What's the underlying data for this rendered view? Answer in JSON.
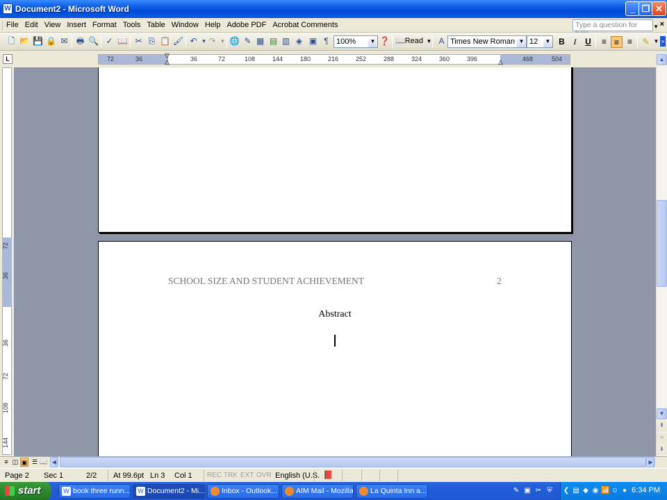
{
  "window": {
    "title": "Document2 - Microsoft Word",
    "app_icon": "W"
  },
  "menu": {
    "items": [
      "File",
      "Edit",
      "View",
      "Insert",
      "Format",
      "Tools",
      "Table",
      "Window",
      "Help",
      "Adobe PDF",
      "Acrobat Comments"
    ],
    "help_placeholder": "Type a question for help",
    "close_glyph": "×"
  },
  "toolbar": {
    "zoom": "100%",
    "read_label": "Read",
    "font_name": "Times New Roman",
    "font_size": "12",
    "bold": "B",
    "italic": "I",
    "underline": "U",
    "para_mark": "¶"
  },
  "ruler": {
    "h_ticks": [
      "72",
      "36",
      "36",
      "72",
      "108",
      "144",
      "180",
      "216",
      "252",
      "288",
      "324",
      "360",
      "396",
      "468",
      "504"
    ],
    "v_ticks": [
      "72",
      "36",
      "36",
      "72",
      "108",
      "144"
    ],
    "tab_selector": "L"
  },
  "document": {
    "header_text": "SCHOOL SIZE AND STUDENT ACHIEVEMENT",
    "page_number": "2",
    "heading": "Abstract"
  },
  "status": {
    "page": "Page 2",
    "section": "Sec 1",
    "page_of": "2/2",
    "at": "At 99.6pt",
    "line": "Ln 3",
    "col": "Col 1",
    "rec": "REC",
    "trk": "TRK",
    "ext": "EXT",
    "ovr": "OVR",
    "language": "English (U.S."
  },
  "taskbar": {
    "start_label": "start",
    "tasks": [
      {
        "label": "book three runn..."
      },
      {
        "label": "Document2 - Mi..."
      },
      {
        "label": "Inbox - Outlook..."
      },
      {
        "label": "AIM Mail - Mozilla..."
      },
      {
        "label": "La Quinta Inn a..."
      }
    ],
    "clock": "6:34 PM"
  },
  "colors": {
    "titlebar": "#0A5BE0",
    "doc_background": "#8e96a8",
    "taskbar": "#245edb",
    "start_button": "#2f8a2f"
  }
}
